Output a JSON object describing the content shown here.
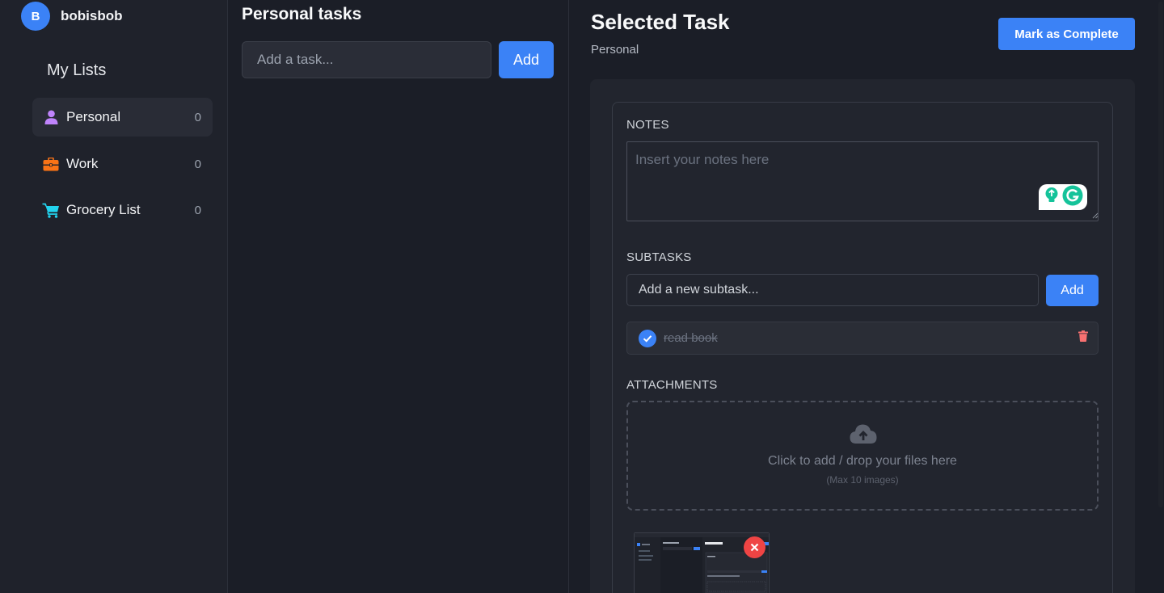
{
  "user": {
    "initial": "B",
    "name": "bobisbob"
  },
  "sidebar": {
    "title": "My Lists",
    "items": [
      {
        "label": "Personal",
        "count": "0",
        "icon": "user-icon",
        "color": "#c084fc"
      },
      {
        "label": "Work",
        "count": "0",
        "icon": "briefcase-icon",
        "color": "#f97316"
      },
      {
        "label": "Grocery List",
        "count": "0",
        "icon": "cart-icon",
        "color": "#22d3ee"
      }
    ]
  },
  "tasks": {
    "title": "Personal tasks",
    "input_placeholder": "Add a task...",
    "add_label": "Add"
  },
  "detail": {
    "title": "Selected Task",
    "list_name": "Personal",
    "complete_label": "Mark as Complete",
    "notes": {
      "label": "NOTES",
      "placeholder": "Insert your notes here"
    },
    "subtasks": {
      "label": "SUBTASKS",
      "input_placeholder": "Add a new subtask...",
      "add_label": "Add",
      "items": [
        {
          "text": "read book",
          "done": true
        }
      ]
    },
    "attachments": {
      "label": "ATTACHMENTS",
      "drop_text": "Click to add / drop your files here",
      "drop_limit": "(Max 10 images)"
    }
  },
  "colors": {
    "accent": "#3b82f6",
    "danger": "#ef4444",
    "background": "#1b1e27"
  }
}
